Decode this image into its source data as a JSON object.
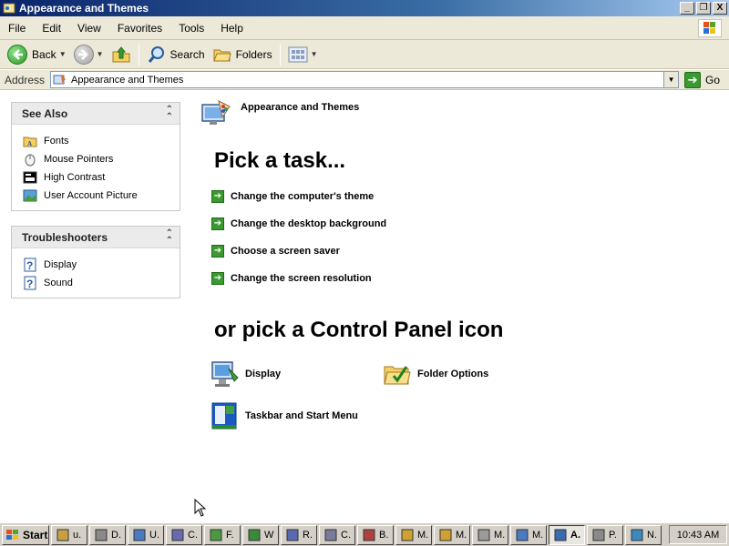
{
  "window": {
    "title": "Appearance and Themes",
    "buttons": [
      "_",
      "❐",
      "X"
    ]
  },
  "menubar": {
    "items": [
      "File",
      "Edit",
      "View",
      "Favorites",
      "Tools",
      "Help"
    ]
  },
  "toolbar": {
    "back_label": "Back",
    "search_label": "Search",
    "folders_label": "Folders"
  },
  "address": {
    "label": "Address",
    "value": "Appearance and Themes",
    "go_label": "Go"
  },
  "see_also": {
    "title": "See Also",
    "items": [
      {
        "label": "Fonts",
        "icon": "fonts-folder-icon"
      },
      {
        "label": "Mouse Pointers",
        "icon": "mouse-icon"
      },
      {
        "label": "High Contrast",
        "icon": "high-contrast-icon"
      },
      {
        "label": "User Account Picture",
        "icon": "user-picture-icon"
      }
    ]
  },
  "troubleshooters": {
    "title": "Troubleshooters",
    "items": [
      {
        "label": "Display",
        "icon": "help-icon"
      },
      {
        "label": "Sound",
        "icon": "help-icon"
      }
    ]
  },
  "main": {
    "category_title": "Appearance and Themes",
    "pick_task": "Pick a task...",
    "tasks": [
      "Change the computer's theme",
      "Change the desktop background",
      "Choose a screen saver",
      "Change the screen resolution"
    ],
    "pick_icon": "or pick a Control Panel icon",
    "icons": [
      {
        "label": "Display",
        "icon": "display-icon"
      },
      {
        "label": "Folder Options",
        "icon": "folder-options-icon"
      },
      {
        "label": "Taskbar and Start Menu",
        "icon": "taskbar-icon"
      }
    ]
  },
  "taskbar": {
    "start_label": "Start",
    "buttons": [
      "u.",
      "D.",
      "U.",
      "C.",
      "F.",
      "W",
      "R.",
      "C.",
      "B.",
      "M.",
      "M.",
      "M.",
      "M.",
      "A.",
      "P.",
      "N."
    ],
    "active_index": 13,
    "clock": "10:43 AM"
  }
}
